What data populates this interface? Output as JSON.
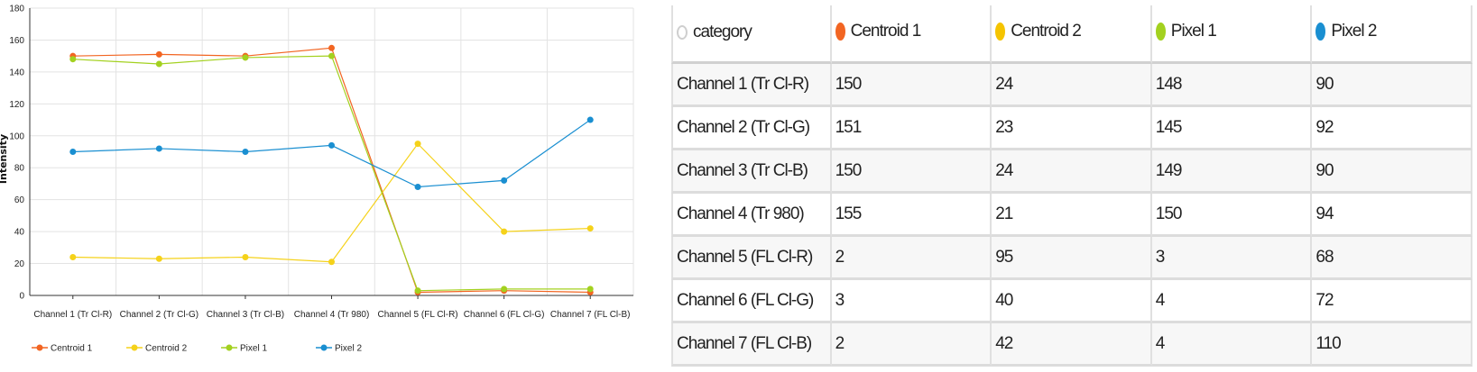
{
  "chart_data": {
    "type": "line",
    "ylabel": "Intensity",
    "ylim": [
      0,
      180
    ],
    "yticks": [
      0,
      20,
      40,
      60,
      80,
      100,
      120,
      140,
      160,
      180
    ],
    "grid": true,
    "legend_position": "bottom-left",
    "categories": [
      "Channel 1 (Tr Cl-R)",
      "Channel 2 (Tr Cl-G)",
      "Channel 3 (Tr Cl-B)",
      "Channel 4 (Tr 980)",
      "Channel 5 (FL Cl-R)",
      "Channel 6 (FL Cl-G)",
      "Channel 7 (FL Cl-B)"
    ],
    "series": [
      {
        "name": "Centroid 1",
        "color": "#f26522",
        "values": [
          150,
          151,
          150,
          155,
          2,
          3,
          2
        ]
      },
      {
        "name": "Centroid 2",
        "color": "#f5d21a",
        "values": [
          24,
          23,
          24,
          21,
          95,
          40,
          42
        ]
      },
      {
        "name": "Pixel 1",
        "color": "#a3d11f",
        "values": [
          148,
          145,
          149,
          150,
          3,
          4,
          4
        ]
      },
      {
        "name": "Pixel 2",
        "color": "#1a8fd1",
        "values": [
          90,
          92,
          90,
          94,
          68,
          72,
          110
        ]
      }
    ]
  },
  "table": {
    "category_header": "category",
    "category_icon": "hollow-circle-icon",
    "columns": [
      {
        "label": "Centroid 1",
        "color": "#f26522"
      },
      {
        "label": "Centroid 2",
        "color": "#f5c400"
      },
      {
        "label": "Pixel 1",
        "color": "#a3d11f"
      },
      {
        "label": "Pixel 2",
        "color": "#1a8fd1"
      }
    ],
    "rows": [
      {
        "category": "Channel 1 (Tr Cl-R)",
        "values": [
          "150",
          "24",
          "148",
          "90"
        ]
      },
      {
        "category": "Channel 2 (Tr Cl-G)",
        "values": [
          "151",
          "23",
          "145",
          "92"
        ]
      },
      {
        "category": "Channel 3 (Tr Cl-B)",
        "values": [
          "150",
          "24",
          "149",
          "90"
        ]
      },
      {
        "category": "Channel 4 (Tr 980)",
        "values": [
          "155",
          "21",
          "150",
          "94"
        ]
      },
      {
        "category": "Channel 5 (FL Cl-R)",
        "values": [
          "2",
          "95",
          "3",
          "68"
        ]
      },
      {
        "category": "Channel 6 (FL Cl-G)",
        "values": [
          "3",
          "40",
          "4",
          "72"
        ]
      },
      {
        "category": "Channel 7 (FL Cl-B)",
        "values": [
          "2",
          "42",
          "4",
          "110"
        ]
      }
    ]
  }
}
